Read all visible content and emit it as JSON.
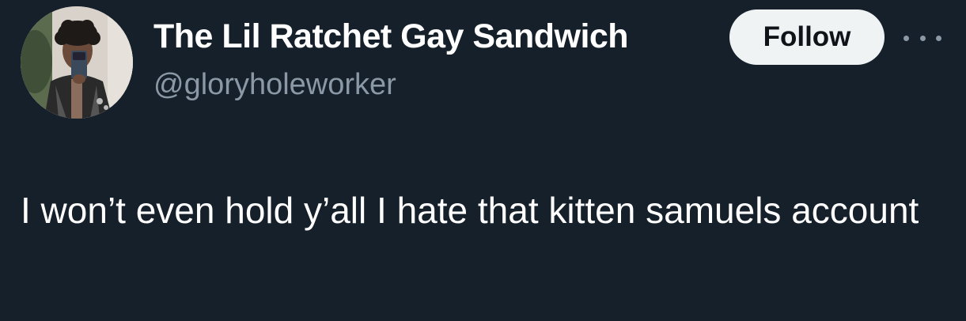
{
  "author": {
    "display_name": "The Lil Ratchet Gay Sandwich",
    "handle": "@gloryholeworker"
  },
  "actions": {
    "follow_label": "Follow",
    "more_icon": "more-horizontal-icon"
  },
  "tweet": {
    "text": "I won’t even hold y’all I hate that kitten samuels account"
  },
  "colors": {
    "background": "#15202b",
    "primary_text": "#ffffff",
    "secondary_text": "#8b98a5",
    "follow_bg": "#eff3f4",
    "follow_text": "#0f1419"
  }
}
